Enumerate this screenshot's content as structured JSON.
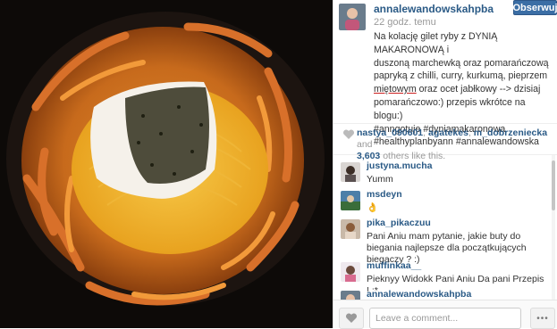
{
  "post": {
    "username": "annalewandowskahpba",
    "time_ago": "22 godz. temu",
    "follow_label": "Obserwuj",
    "caption_lines": [
      "Na kolację gilet ryby z DYNIĄ MAKARONOWĄ i",
      "duszoną marchewką oraz pomarańczową",
      "papryką z chilli, curry, kurkumą, pieprzem",
      "oraz ocet jabłkowy --> dzisiaj",
      "pomarańczowo:) przepis wkrótce na blogu:)",
      "#anngotuje #dyniamakaronowa",
      "#healthyplanbyann #annalewandowska"
    ],
    "caption_underlined": "miętowym"
  },
  "likes": {
    "users": [
      "nastya_090601",
      "agatekes",
      "m_dobrzeniecka"
    ],
    "sep1": ", ",
    "sep2": ", ",
    "and_label": " and",
    "count": "3,603",
    "tail": " others like this."
  },
  "comments": [
    {
      "user": "justyna.mucha",
      "text": "Yumm"
    },
    {
      "user": "msdeyn",
      "text": "👌"
    },
    {
      "user": "pika_pikaczuu",
      "text": "Pani Aniu mam pytanie, jakie buty do biegania najlepsze dla początkujących biegaczy ? :)"
    },
    {
      "user": "muffinkaa__",
      "text": "Pieknyy Widokk Pani Aniu Da pani Przepis ! :*"
    },
    {
      "user": "annalewandowskahpba",
      "text": ""
    }
  ],
  "input": {
    "placeholder": "Leave a comment..."
  },
  "more_label": "•••",
  "icons": {
    "heart": "heart-icon",
    "like": "heart-button-icon",
    "more": "more-icon"
  },
  "colors": {
    "link": "#2a5a86",
    "follow_bg": "#3b6ea5",
    "underline": "#cc1f1f"
  }
}
